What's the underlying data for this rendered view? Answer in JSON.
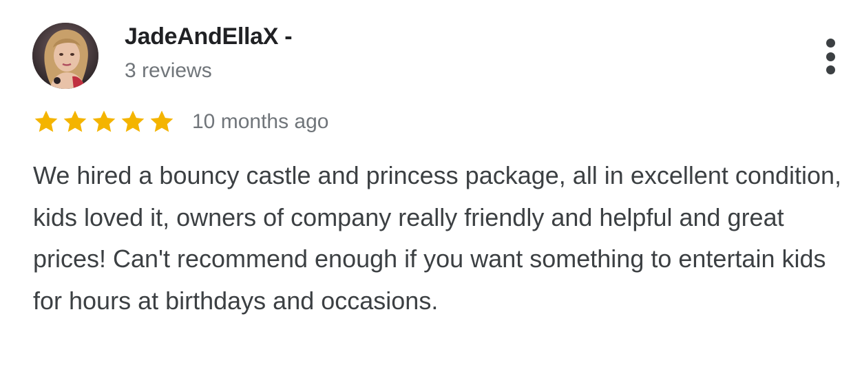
{
  "review": {
    "author_name": "JadeAndEllaX -",
    "review_count": "3 reviews",
    "rating": 5,
    "rating_max": 5,
    "time_ago": "10 months ago",
    "text": "We hired a bouncy castle and princess package, all in excellent condition, kids loved it, owners of company really friendly and helpful and great prices! Can't recommend enough if you want something to entertain kids for hours at birthdays and occasions.",
    "avatar_icon": "user-photo",
    "more_icon": "more-vert-icon"
  },
  "colors": {
    "star": "#f4b400",
    "name": "#202124",
    "secondary_text": "#70757a",
    "body_text": "#3c4043"
  }
}
